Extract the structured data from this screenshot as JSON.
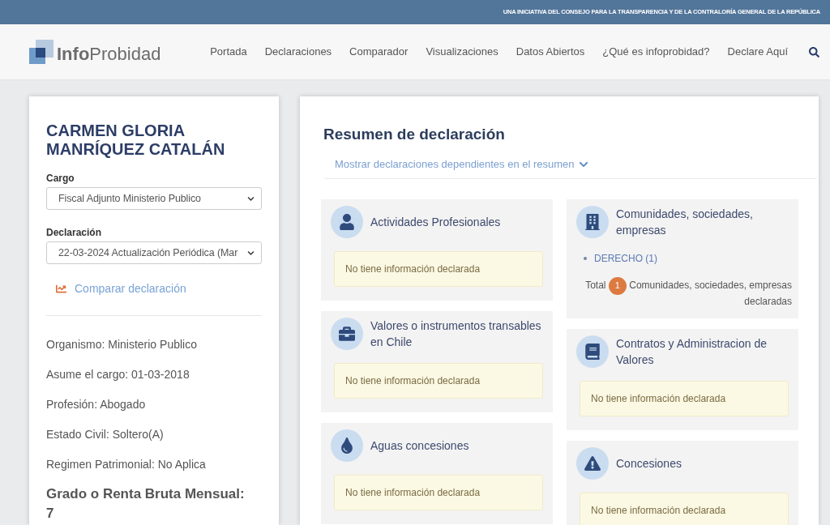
{
  "top_bar": {
    "text": "UNA INICIATIVA DEL CONSEJO PARA LA TRANSPARENCIA Y DE LA CONTRALORÍA GENERAL DE LA REPÚBLICA"
  },
  "header": {
    "logo": "**Info**Probidad",
    "nav": [
      "Portada",
      "Declaraciones",
      "Comparador",
      "Visualizaciones",
      "Datos Abiertos",
      "¿Qué es infoprobidad?",
      "Declare Aquí"
    ]
  },
  "profile": {
    "name": "CARMEN GLORIA MANRÍQUEZ CATALÁN",
    "fields": [
      {
        "label": "Cargo",
        "value": "Fiscal Adjunto Ministerio Publico"
      },
      {
        "label": "Declaración",
        "value": "22-03-2024 Actualización Periódica (Mar"
      }
    ],
    "compare_link": "Comparar declaración",
    "details": [
      "Organismo: Ministerio Publico",
      "Asume el cargo: 01-03-2018",
      "Profesión: Abogado",
      "Estado Civil: Soltero(A)",
      "Regimen Patrimonial: No Aplica"
    ],
    "salary": {
      "label": "Grado o Renta Bruta Mensual:",
      "value": "7"
    }
  },
  "summary": {
    "title": "Resumen de declaración",
    "toggle": "Mostrar declaraciones dependientes en el resumen",
    "columns": [
      {
        "sections": [
          {
            "kind": "empty",
            "title": "Actividades Profesionales",
            "notice": "No tiene información declarada"
          },
          {
            "kind": "empty",
            "title": "Valores o instrumentos transables en Chile",
            "notice": "No tiene información declarada"
          },
          {
            "kind": "empty",
            "title": "Aguas concesiones",
            "notice": "No tiene información declarada"
          }
        ]
      },
      {
        "sections": [
          {
            "kind": "list",
            "title": "Comunidades, sociedades, empresas",
            "items": [
              "DERECHO (1)"
            ],
            "total": {
              "label": "Total",
              "count": "1",
              "caption": "Comunidades, sociedades, empresas declaradas"
            }
          },
          {
            "kind": "empty",
            "title": "Contratos y Administracion de Valores",
            "notice": "No tiene información declarada"
          },
          {
            "kind": "empty",
            "title": "Concesiones",
            "notice": "No tiene información declarada"
          }
        ]
      }
    ]
  }
}
